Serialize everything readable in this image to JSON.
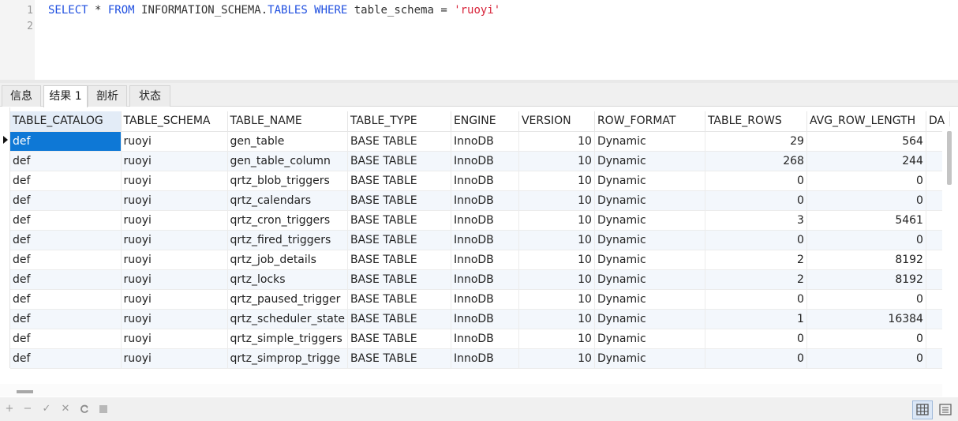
{
  "editor": {
    "line_numbers": [
      "1",
      "2"
    ],
    "query": {
      "kw_select": "SELECT",
      "star": " * ",
      "kw_from": "FROM",
      "schema_part": " INFORMATION_SCHEMA.",
      "kw_tables": "TABLES",
      "kw_where": " WHERE",
      "condition": " table_schema = ",
      "value": "'ruoyi'"
    }
  },
  "tabs": [
    {
      "label": "信息"
    },
    {
      "label": "结果 1"
    },
    {
      "label": "剖析"
    },
    {
      "label": "状态"
    }
  ],
  "active_tab": "结果 1",
  "grid": {
    "columns": [
      "TABLE_CATALOG",
      "TABLE_SCHEMA",
      "TABLE_NAME",
      "TABLE_TYPE",
      "ENGINE",
      "VERSION",
      "ROW_FORMAT",
      "TABLE_ROWS",
      "AVG_ROW_LENGTH",
      "DA"
    ],
    "rows": [
      [
        "def",
        "ruoyi",
        "gen_table",
        "BASE TABLE",
        "InnoDB",
        "10",
        "Dynamic",
        "29",
        "564"
      ],
      [
        "def",
        "ruoyi",
        "gen_table_column",
        "BASE TABLE",
        "InnoDB",
        "10",
        "Dynamic",
        "268",
        "244"
      ],
      [
        "def",
        "ruoyi",
        "qrtz_blob_triggers",
        "BASE TABLE",
        "InnoDB",
        "10",
        "Dynamic",
        "0",
        "0"
      ],
      [
        "def",
        "ruoyi",
        "qrtz_calendars",
        "BASE TABLE",
        "InnoDB",
        "10",
        "Dynamic",
        "0",
        "0"
      ],
      [
        "def",
        "ruoyi",
        "qrtz_cron_triggers",
        "BASE TABLE",
        "InnoDB",
        "10",
        "Dynamic",
        "3",
        "5461"
      ],
      [
        "def",
        "ruoyi",
        "qrtz_fired_triggers",
        "BASE TABLE",
        "InnoDB",
        "10",
        "Dynamic",
        "0",
        "0"
      ],
      [
        "def",
        "ruoyi",
        "qrtz_job_details",
        "BASE TABLE",
        "InnoDB",
        "10",
        "Dynamic",
        "2",
        "8192"
      ],
      [
        "def",
        "ruoyi",
        "qrtz_locks",
        "BASE TABLE",
        "InnoDB",
        "10",
        "Dynamic",
        "2",
        "8192"
      ],
      [
        "def",
        "ruoyi",
        "qrtz_paused_trigger",
        "BASE TABLE",
        "InnoDB",
        "10",
        "Dynamic",
        "0",
        "0"
      ],
      [
        "def",
        "ruoyi",
        "qrtz_scheduler_state",
        "BASE TABLE",
        "InnoDB",
        "10",
        "Dynamic",
        "1",
        "16384"
      ],
      [
        "def",
        "ruoyi",
        "qrtz_simple_triggers",
        "BASE TABLE",
        "InnoDB",
        "10",
        "Dynamic",
        "0",
        "0"
      ],
      [
        "def",
        "ruoyi",
        "qrtz_simprop_trigge",
        "BASE TABLE",
        "InnoDB",
        "10",
        "Dynamic",
        "0",
        "0"
      ]
    ],
    "numeric_columns": [
      5,
      7,
      8
    ],
    "selected_cell": {
      "row": 0,
      "col": 0
    }
  },
  "toolbar": {
    "buttons": [
      {
        "name": "add-record-icon",
        "glyph": "+"
      },
      {
        "name": "delete-record-icon",
        "glyph": "−"
      },
      {
        "name": "apply-changes-icon",
        "glyph": "✓"
      },
      {
        "name": "discard-changes-icon",
        "glyph": "✕"
      },
      {
        "name": "refresh-icon",
        "glyph": "C"
      },
      {
        "name": "stop-icon",
        "glyph": "■"
      }
    ],
    "views": [
      {
        "name": "grid-view-icon",
        "active": true
      },
      {
        "name": "form-view-icon",
        "active": false
      }
    ]
  },
  "colors": {
    "keyword": "#1f4fe0",
    "string": "#d8243a",
    "selection": "#0e78d6",
    "header_selected": "#e3ecf7"
  }
}
